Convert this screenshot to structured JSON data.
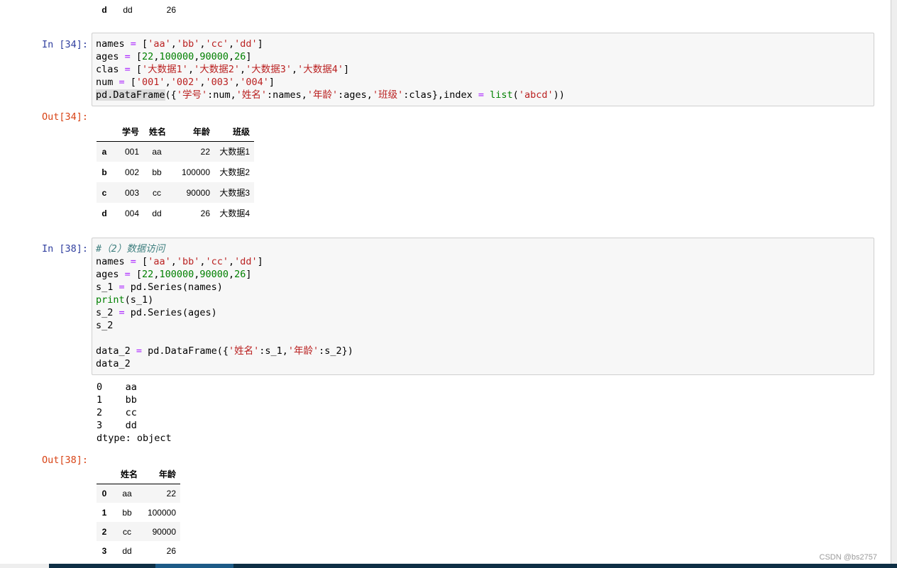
{
  "cells": [
    {
      "prompt_in": "In [34]:",
      "prompt_out": "Out[34]:",
      "columns": [
        "学号",
        "姓名",
        "年龄",
        "班级"
      ],
      "rows": [
        {
          "idx": "a",
          "vals": [
            "001",
            "aa",
            "22",
            "大数据1"
          ]
        },
        {
          "idx": "b",
          "vals": [
            "002",
            "bb",
            "100000",
            "大数据2"
          ]
        },
        {
          "idx": "c",
          "vals": [
            "003",
            "cc",
            "90000",
            "大数据3"
          ]
        },
        {
          "idx": "d",
          "vals": [
            "004",
            "dd",
            "26",
            "大数据4"
          ]
        }
      ]
    },
    {
      "prompt_in": "In [38]:",
      "prompt_out": "Out[38]:",
      "stream": [
        "0    aa",
        "1    bb",
        "2    cc",
        "3    dd",
        "dtype: object"
      ],
      "columns": [
        "姓名",
        "年龄"
      ],
      "rows": [
        {
          "idx": "0",
          "vals": [
            "aa",
            "22"
          ]
        },
        {
          "idx": "1",
          "vals": [
            "bb",
            "100000"
          ]
        },
        {
          "idx": "2",
          "vals": [
            "cc",
            "90000"
          ]
        },
        {
          "idx": "3",
          "vals": [
            "dd",
            "26"
          ]
        }
      ]
    }
  ],
  "prev_row": {
    "idx": "d",
    "vals": [
      "dd",
      "26"
    ]
  },
  "watermark": "CSDN @bs2757"
}
